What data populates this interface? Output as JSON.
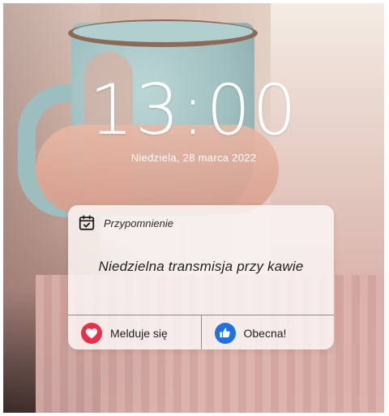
{
  "lockscreen": {
    "time": "13:00",
    "date": "Niedziela, 28 marca 2022"
  },
  "notification": {
    "app_name": "Przypomnienie",
    "app_icon": "calendar-check-icon",
    "message": "Niedzielna transmisja przy kawie",
    "actions": [
      {
        "label": "Melduje się",
        "icon": "heart-icon",
        "color": "#e9304a"
      },
      {
        "label": "Obecna!",
        "icon": "thumbs-up-icon",
        "color": "#1f6fe6"
      }
    ]
  }
}
